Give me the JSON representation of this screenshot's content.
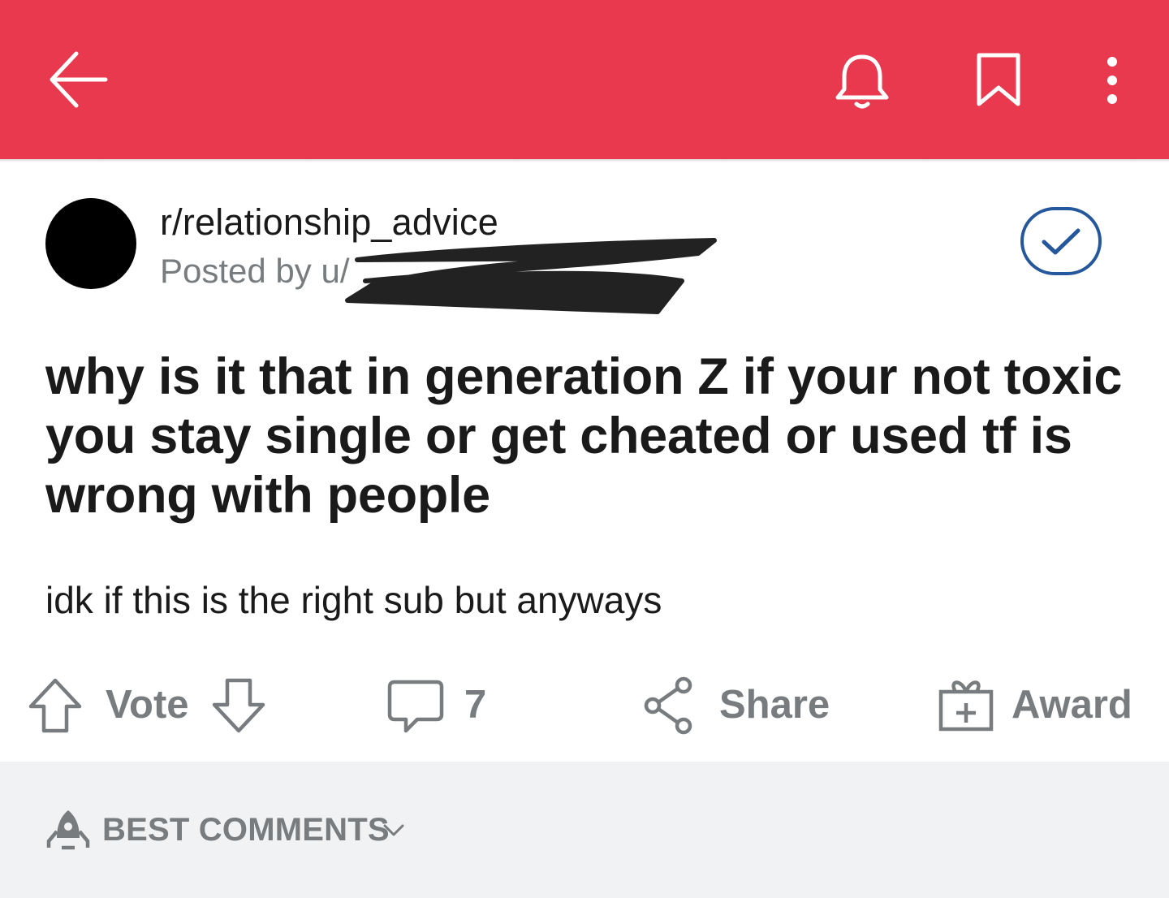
{
  "header": {
    "background_color": "#E9394F",
    "icons": [
      "back-arrow-icon",
      "bell-icon",
      "bookmark-icon",
      "more-vertical-icon"
    ]
  },
  "post": {
    "subreddit": "r/relationship_advice",
    "posted_by": "Posted by u/",
    "title": "why is it that in generation Z if your not toxic you stay single or get cheated or used tf is wrong with people",
    "body": "idk if this is the right sub but anyways"
  },
  "actions": {
    "vote_label": "Vote",
    "comment_count": "7",
    "share_label": "Share",
    "award_label": "Award"
  },
  "comments": {
    "sort_label": "BEST COMMENTS"
  },
  "colors": {
    "accent": "#E9394F",
    "check_blue": "#24579c",
    "muted_text": "#787c7e"
  }
}
